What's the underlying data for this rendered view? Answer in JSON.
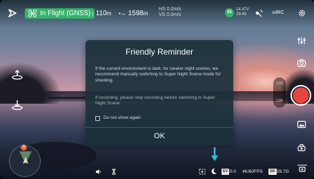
{
  "top_bar": {
    "flight_mode": "In Flight (GNSS)",
    "altitude": "110",
    "altitude_unit": "m",
    "distance": "1598",
    "distance_unit": "m",
    "h_speed": "HS 0.0m/s",
    "v_speed": "VS 0.0m/s",
    "battery_percent": "55",
    "battery_voltage": "14.47V",
    "battery_time": "29:49",
    "signal_label": "RC",
    "icons": [
      "back-icon",
      "satellite-icon",
      "signal-icon",
      "settings-icon"
    ]
  },
  "dialog": {
    "title": "Friendly Reminder",
    "body": "If the current environment is dark, for clearer night scenes, we recommend manually switching to Super Night Scene mode for shooting.",
    "note": "If recording, please stop recording before switching to Super Night Scene.",
    "checkbox_label": "Do not show again",
    "ok_label": "OK"
  },
  "right_panel": {
    "zoom_top": "1.0X",
    "zoom_bottom": "1.0X"
  },
  "map": {
    "badge": "N"
  },
  "bottom_bar": {
    "ev_tag": "EV",
    "ev_value": "0.0",
    "resolution": "4K/60FPS",
    "storage_tag": "SD",
    "storage_time": "29.7G"
  },
  "colors": {
    "mode_pill": "#33b46a",
    "shutter": "#e5463d",
    "arrow_hint": "#2ec3d6"
  }
}
